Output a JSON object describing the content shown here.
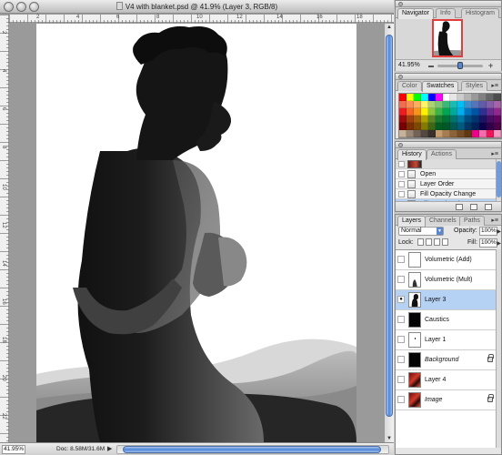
{
  "document": {
    "title": "V4 with blanket.psd @ 41.9% (Layer 3, RGB/8)",
    "zoom": "41.95%",
    "doc_size": "Doc: 8.58M/31.6M",
    "ruler_top": [
      "2",
      "4",
      "6",
      "8",
      "10",
      "12",
      "14",
      "16",
      "18"
    ],
    "ruler_left": [
      "2",
      "4",
      "6",
      "8",
      "10",
      "12",
      "14",
      "16",
      "18",
      "20",
      "22"
    ]
  },
  "navigator": {
    "tabs": [
      "Navigator",
      "Info",
      "Histogram"
    ],
    "zoom": "41.95%"
  },
  "swatches": {
    "tabs": [
      "Color",
      "Swatches",
      "Styles"
    ],
    "colors": [
      "#ff0000",
      "#ffff00",
      "#00ff00",
      "#00ffff",
      "#0000ff",
      "#ff00ff",
      "#ffffff",
      "#e6e6e6",
      "#cccccc",
      "#b3b3b3",
      "#999999",
      "#808080",
      "#666666",
      "#4d4d4d",
      "#f26c4f",
      "#f68e55",
      "#fbaf5c",
      "#fff467",
      "#acd372",
      "#7cc576",
      "#3bb878",
      "#1abbb4",
      "#00bff3",
      "#438ccb",
      "#5574b9",
      "#605ca8",
      "#855fa8",
      "#a763a9",
      "#ed1c24",
      "#f26522",
      "#f7941d",
      "#fff200",
      "#8dc63f",
      "#39b54a",
      "#00a651",
      "#00a99d",
      "#00aeef",
      "#0072bc",
      "#0054a6",
      "#2e3192",
      "#662d91",
      "#92278f",
      "#9e0b0f",
      "#a0410d",
      "#a36209",
      "#aba000",
      "#598527",
      "#1a7b30",
      "#007236",
      "#00746b",
      "#0076a3",
      "#004b80",
      "#003471",
      "#1b1464",
      "#440e62",
      "#630460",
      "#790000",
      "#7b2e00",
      "#7d4900",
      "#827b00",
      "#406618",
      "#005e20",
      "#005826",
      "#005952",
      "#005b7f",
      "#003663",
      "#002157",
      "#0d004c",
      "#32004b",
      "#4b0049",
      "#c7b299",
      "#998675",
      "#736357",
      "#534741",
      "#37302d",
      "#c69c6d",
      "#a67c52",
      "#8c6239",
      "#754c24",
      "#603913",
      "#ec008c",
      "#f06eaa",
      "#ed145b",
      "#f49ac2"
    ]
  },
  "history": {
    "tabs": [
      "History",
      "Actions"
    ],
    "items": [
      {
        "label": "",
        "selected": false
      },
      {
        "label": "Open",
        "selected": false
      },
      {
        "label": "Layer Order",
        "selected": false
      },
      {
        "label": "Fill Opacity Change",
        "selected": false
      },
      {
        "label": "Fill Opacity Change",
        "selected": true
      }
    ]
  },
  "layers": {
    "tabs": [
      "Layers",
      "Channels",
      "Paths"
    ],
    "blend_mode": "Normal",
    "opacity_label": "Opacity:",
    "opacity": "100%",
    "lock_label": "Lock:",
    "fill_label": "Fill:",
    "fill": "100%",
    "items": [
      {
        "name": "Volumetric (Add)",
        "italic": false,
        "selected": false,
        "visible": false,
        "locked": false,
        "thumb": "white-light"
      },
      {
        "name": "Volumetric (Mult)",
        "italic": false,
        "selected": false,
        "visible": false,
        "locked": false,
        "thumb": "white-dark"
      },
      {
        "name": "Layer 3",
        "italic": false,
        "selected": true,
        "visible": true,
        "locked": false,
        "thumb": "silhouette"
      },
      {
        "name": "Caustics",
        "italic": false,
        "selected": false,
        "visible": false,
        "locked": false,
        "thumb": "black"
      },
      {
        "name": "Layer 1",
        "italic": false,
        "selected": false,
        "visible": false,
        "locked": false,
        "thumb": "white"
      },
      {
        "name": "Background",
        "italic": true,
        "selected": false,
        "visible": false,
        "locked": true,
        "thumb": "black"
      },
      {
        "name": "Layer 4",
        "italic": false,
        "selected": false,
        "visible": false,
        "locked": false,
        "thumb": "red-photo"
      },
      {
        "name": "Image",
        "italic": true,
        "selected": false,
        "visible": false,
        "locked": true,
        "thumb": "red-photo"
      }
    ]
  }
}
